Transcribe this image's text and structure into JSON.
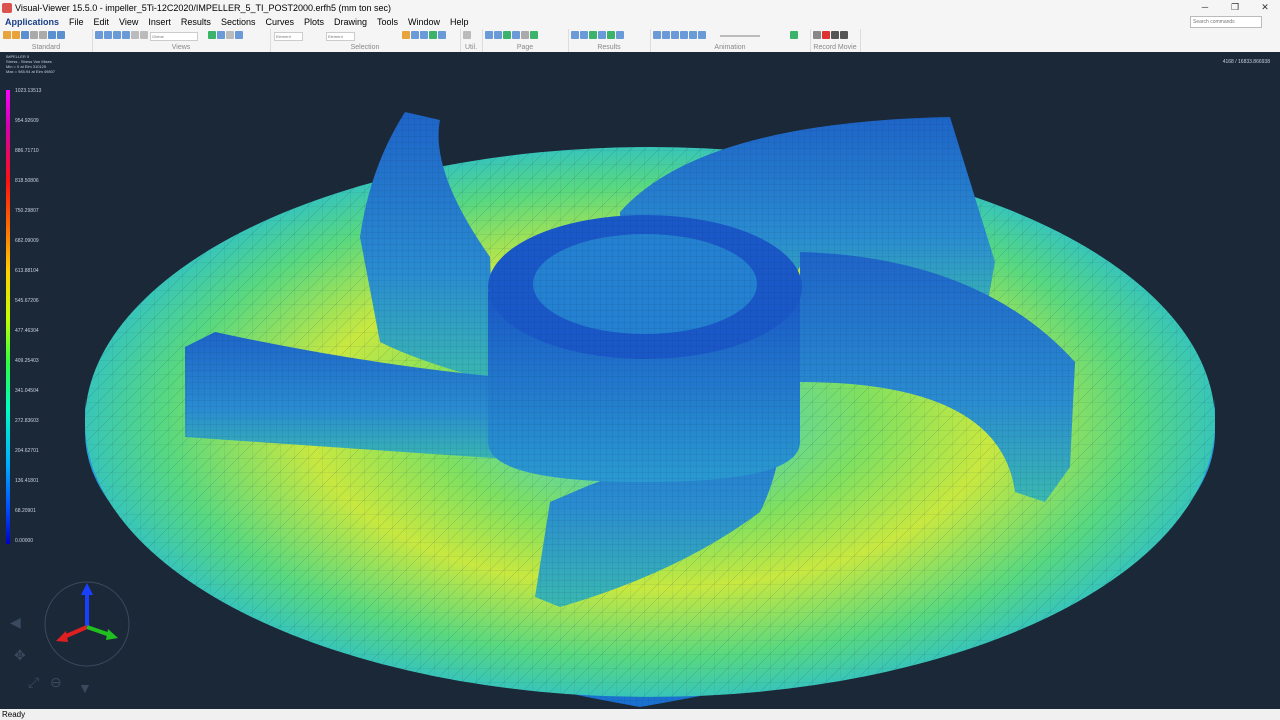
{
  "window": {
    "title": "Visual-Viewer 15.5.0 - impeller_5Ti-12C2020/IMPELLER_5_TI_POST2000.erfh5 (mm ton sec)",
    "minimize": "─",
    "restore": "❐",
    "close": "✕"
  },
  "menu": {
    "items": [
      "Applications",
      "File",
      "Edit",
      "View",
      "Insert",
      "Results",
      "Sections",
      "Curves",
      "Plots",
      "Drawing",
      "Tools",
      "Window",
      "Help"
    ],
    "search_placeholder": "Search commands"
  },
  "toolbar": {
    "groups": [
      "Standard",
      "Views",
      "Selection",
      "Util.",
      "Page",
      "Results",
      "Animation",
      "Record Movie"
    ],
    "dropdowns": [
      "Global",
      "Element",
      "Element"
    ]
  },
  "viewport": {
    "model_name": "IMPELLER 5",
    "result_type": "Stress - Stress Von Mises",
    "min_text": "Min = 0 at Elm 310125",
    "max_text": "Max = 985.94 at Elm 49807",
    "node_count": "4168 / 16833.866938",
    "legend": [
      "1023.13513",
      "954.92609",
      "886.71710",
      "818.50806",
      "750.29807",
      "682.09009",
      "613.88104",
      "545.67206",
      "477.46304",
      "409.25403",
      "341.04504",
      "272.83603",
      "204.62701",
      "136.41801",
      "68.20901",
      "0.00000"
    ]
  },
  "status": {
    "text": "Ready"
  },
  "colors": {
    "background": "#1b2838",
    "accent": "#1a3e88"
  }
}
